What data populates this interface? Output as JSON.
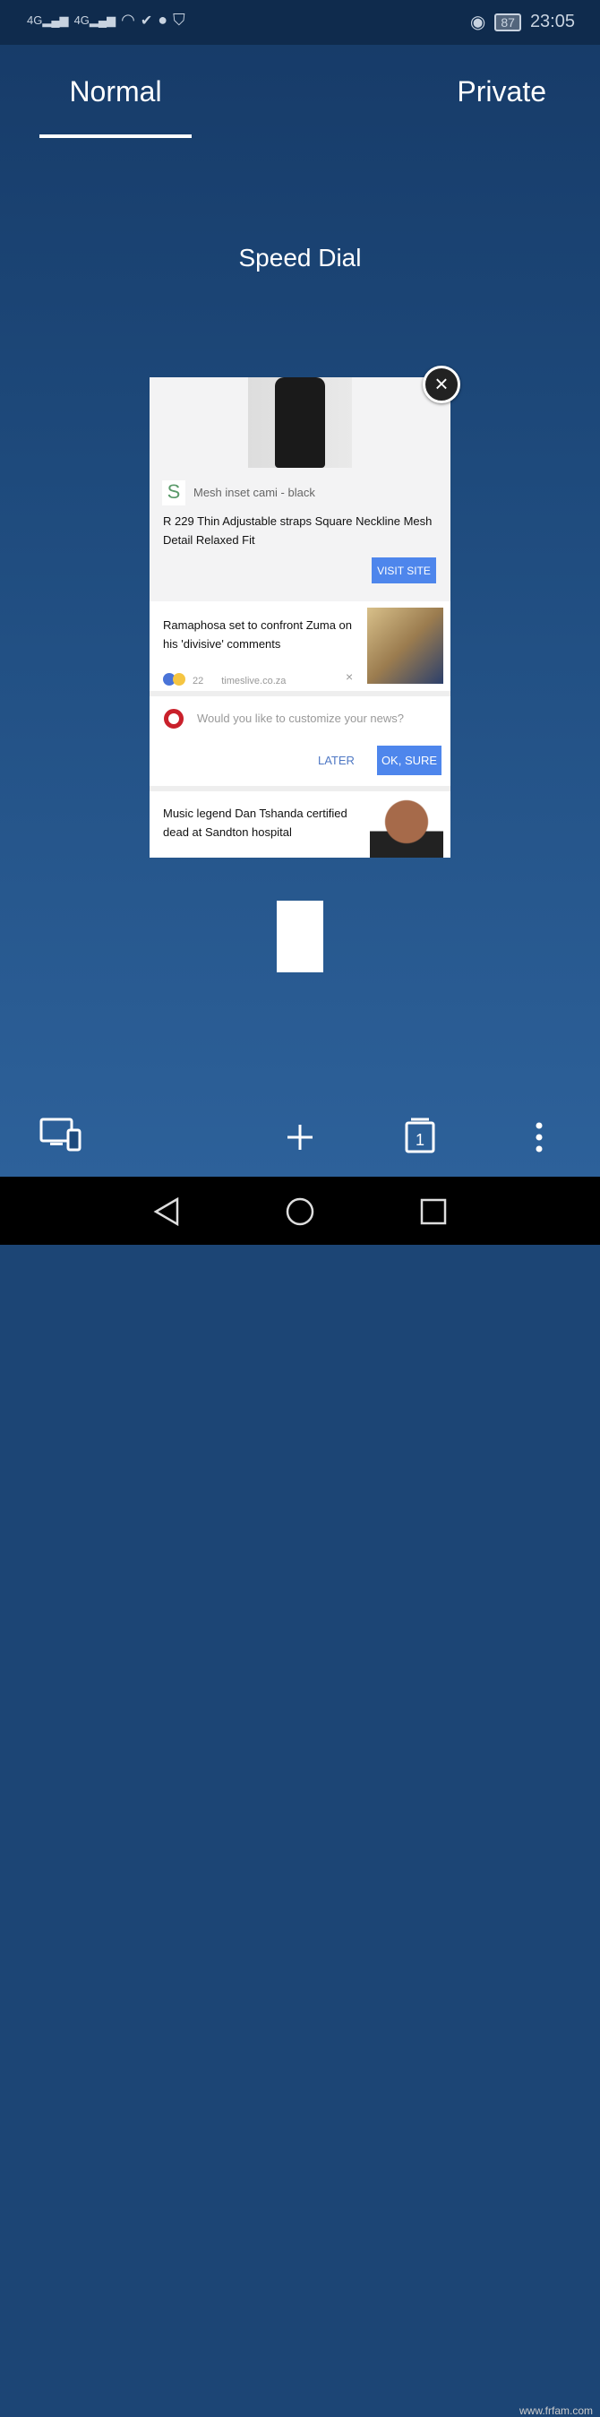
{
  "status_bar": {
    "network1": "4G",
    "network2": "4G",
    "battery": "87",
    "time": "23:05"
  },
  "tabs": {
    "normal": "Normal",
    "private": "Private"
  },
  "tab_card": {
    "title": "Speed Dial",
    "promo": {
      "logo_letter": "S",
      "title": "Mesh inset cami - black",
      "description": "R 229 Thin Adjustable straps Square Neckline Mesh Detail Relaxed Fit",
      "button": "VISIT SITE"
    },
    "news1": {
      "headline": "Ramaphosa set to confront Zuma on his 'divisive' comments",
      "reactions": "22",
      "source": "timeslive.co.za",
      "dismiss": "×"
    },
    "customize": {
      "question": "Would you like to customize your news?",
      "later": "LATER",
      "ok": "OK, SURE"
    },
    "news2": {
      "headline": "Music legend Dan Tshanda certified dead at Sandton hospital"
    },
    "close": "×"
  },
  "watermark": "www.frfam.com",
  "colors": {
    "accent": "#4e86ec",
    "background": "#1e4a7c"
  }
}
